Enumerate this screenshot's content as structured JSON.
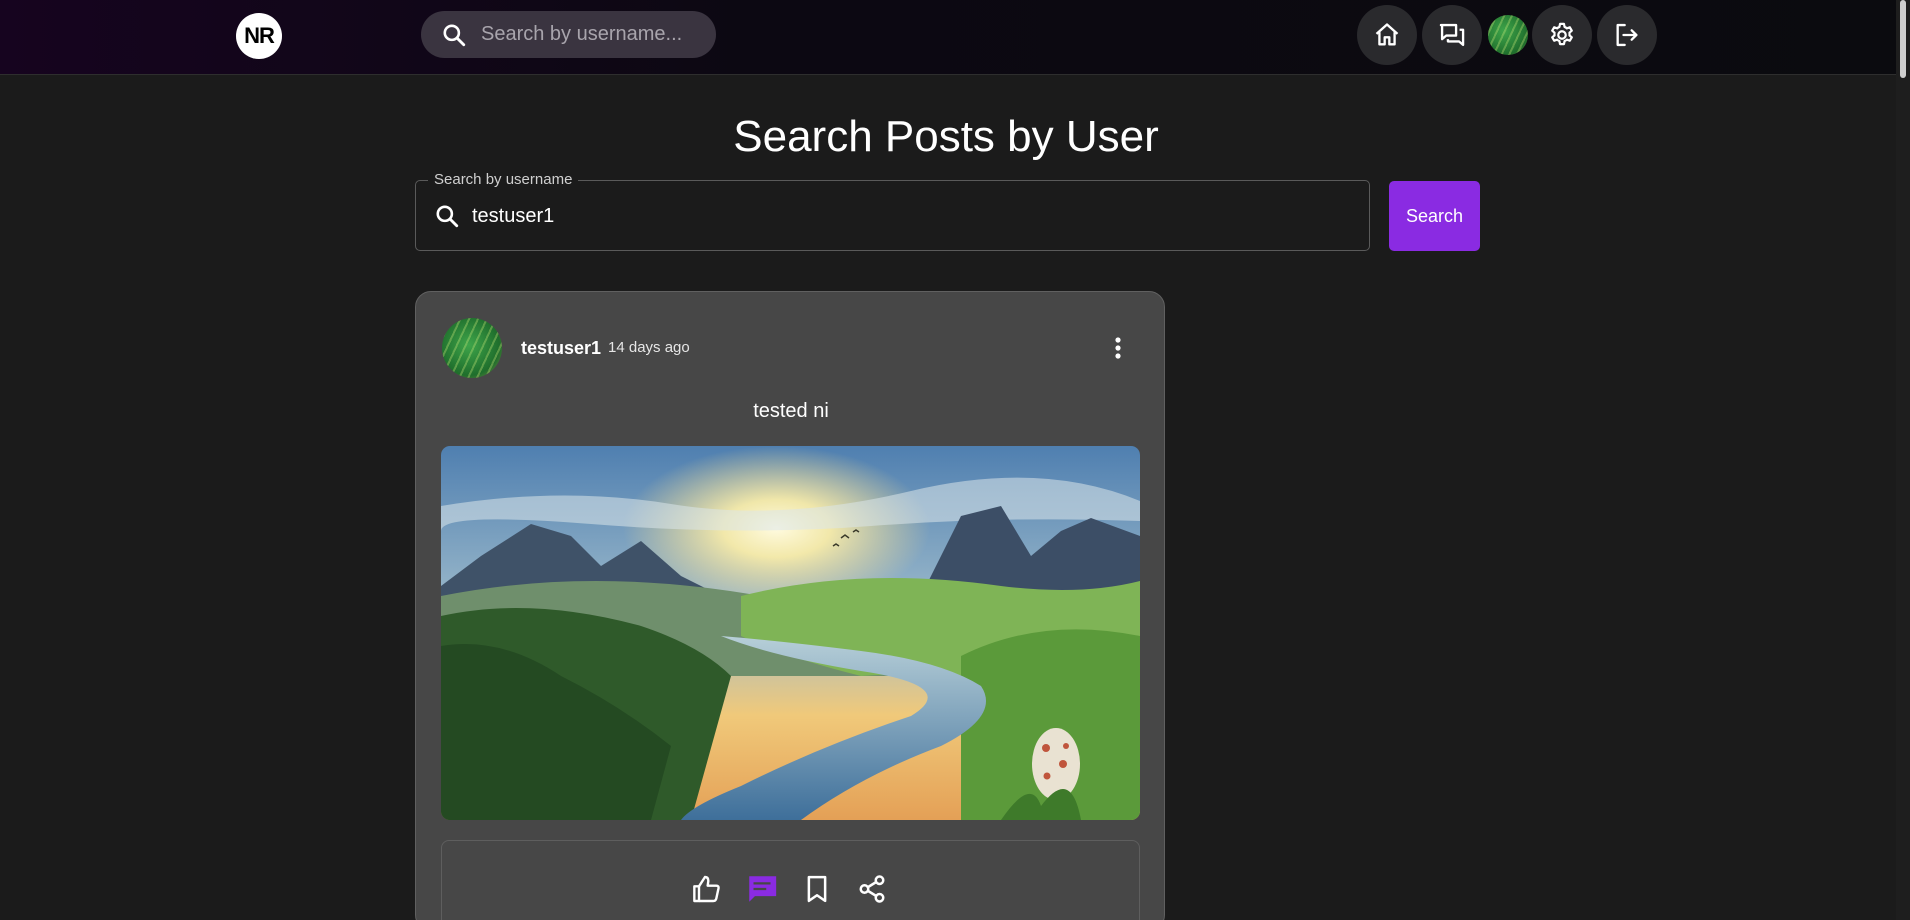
{
  "header": {
    "logo_text": "NR",
    "search_placeholder": "Search by username...",
    "nav": [
      {
        "name": "home-icon"
      },
      {
        "name": "messages-icon"
      },
      {
        "name": "profile-avatar"
      },
      {
        "name": "gear-icon"
      },
      {
        "name": "logout-icon"
      }
    ]
  },
  "main": {
    "title": "Search Posts by User",
    "search": {
      "label": "Search by username",
      "value": "testuser1"
    },
    "search_button": "Search"
  },
  "post": {
    "username": "testuser1",
    "time": "14 days ago",
    "caption": "tested ni",
    "actions": [
      "like-icon",
      "comment-icon",
      "bookmark-icon",
      "share-icon"
    ],
    "active_action_color": "#8a2be2"
  },
  "colors": {
    "accent": "#8a2be2",
    "background": "#1b1b1b",
    "card": "#474747"
  }
}
